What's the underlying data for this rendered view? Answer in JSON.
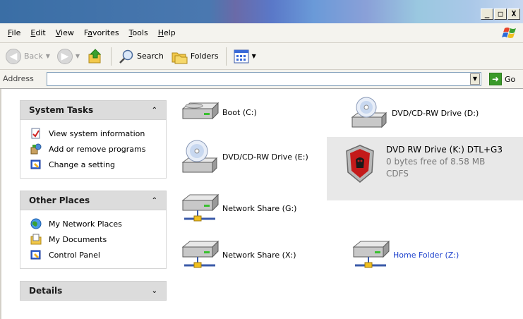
{
  "window": {
    "controls": [
      "_",
      "□",
      "X"
    ]
  },
  "menu": {
    "items": [
      {
        "label": "File",
        "key": "F",
        "rest": "ile"
      },
      {
        "label": "Edit",
        "key": "E",
        "rest": "dit"
      },
      {
        "label": "View",
        "key": "V",
        "rest": "iew"
      },
      {
        "label": "Favorites",
        "key": "a",
        "pre": "F",
        "rest": "vorites"
      },
      {
        "label": "Tools",
        "key": "T",
        "rest": "ools"
      },
      {
        "label": "Help",
        "key": "H",
        "rest": "elp"
      }
    ]
  },
  "toolbar": {
    "back_label": "Back",
    "search_label": "Search",
    "folders_label": "Folders"
  },
  "address": {
    "label": "Address",
    "value": "",
    "go_label": "Go"
  },
  "sidebar": {
    "system_tasks": {
      "title": "System Tasks",
      "items": [
        "View system information",
        "Add or remove programs",
        "Change a setting"
      ]
    },
    "other_places": {
      "title": "Other Places",
      "items": [
        "My Network Places",
        "My Documents",
        "Control Panel"
      ]
    },
    "details": {
      "title": "Details"
    }
  },
  "drives": {
    "boot": "Boot (C:)",
    "dvd_d": "DVD/CD-RW Drive (D:)",
    "dvd_e": "DVD/CD-RW Drive (E:)",
    "k_name": "DVD RW Drive (K:) DTL+G3",
    "k_free": "0 bytes free of 8.58 MB",
    "k_fs": "CDFS",
    "net_g": "Network Share (G:)",
    "net_x": "Network Share (X:)",
    "home_z": "Home Folder (Z:)"
  },
  "colors": {
    "link_blue": "#1a3fcc",
    "go_green": "#3a9a2a",
    "kingston_red": "#c41a1a"
  }
}
